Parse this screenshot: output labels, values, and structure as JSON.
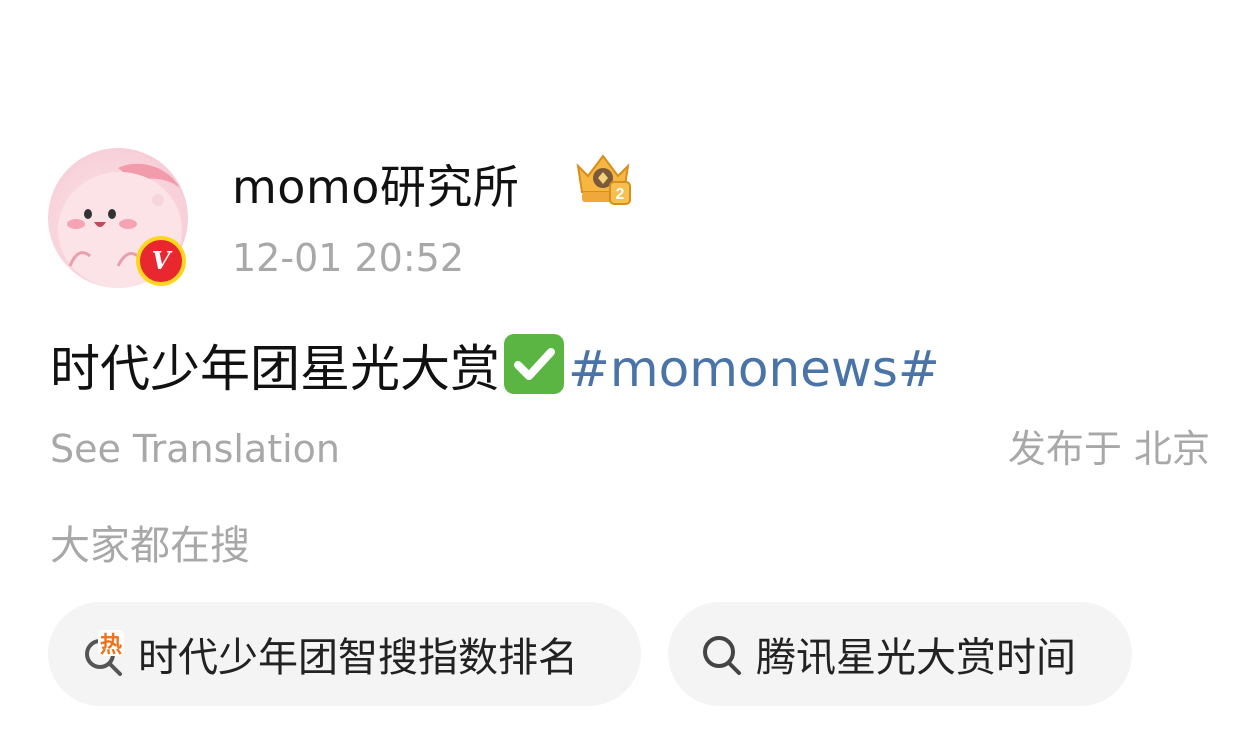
{
  "post": {
    "author": {
      "name": "momo研究所",
      "verified_icon": "v-verified-icon",
      "rank_icon": "crown-rank-badge-icon"
    },
    "timestamp": "12-01 20:52",
    "text_main": "时代少年团星光大赏",
    "emoji": "check-mark-emoji",
    "hashtag": "#momonews#",
    "see_translation": "See Translation",
    "location": "发布于 北京"
  },
  "search_section": {
    "title": "大家都在搜",
    "chips": [
      {
        "icon": "hot-search-icon",
        "label": "时代少年团智搜指数排名"
      },
      {
        "icon": "search-icon",
        "label": "腾讯星光大赏时间"
      }
    ]
  },
  "colors": {
    "hashtag": "#4a74a8",
    "muted_text": "#a8a8a8",
    "chip_bg": "#f4f4f4",
    "verified_red": "#e8272e",
    "hot_orange": "#f2711c"
  }
}
